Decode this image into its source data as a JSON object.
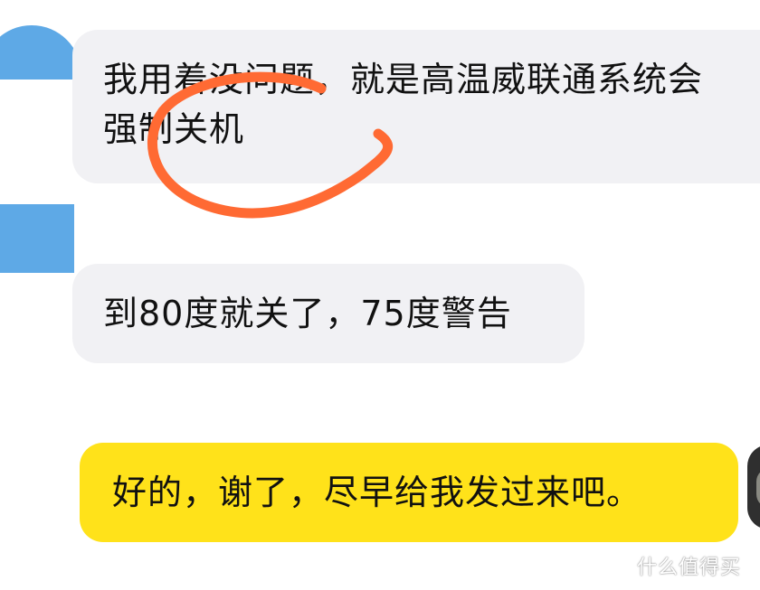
{
  "messages": [
    {
      "sender": "other",
      "text": "我用着没问题，就是高温威联通系统会强制关机"
    },
    {
      "sender": "other",
      "text": "到80度就关了，75度警告"
    },
    {
      "sender": "self",
      "text": "好的，谢了，尽早给我发过来吧。"
    }
  ],
  "annotation": {
    "color": "#ff6a33",
    "shape": "hand-drawn-ellipse"
  },
  "colors": {
    "incoming_bubble": "#f1f1f4",
    "outgoing_bubble": "#ffe21a",
    "contact_avatar": "#5ea9e6"
  },
  "watermark": {
    "text": "什么值得买",
    "icon": "smzdm-logo-icon"
  }
}
